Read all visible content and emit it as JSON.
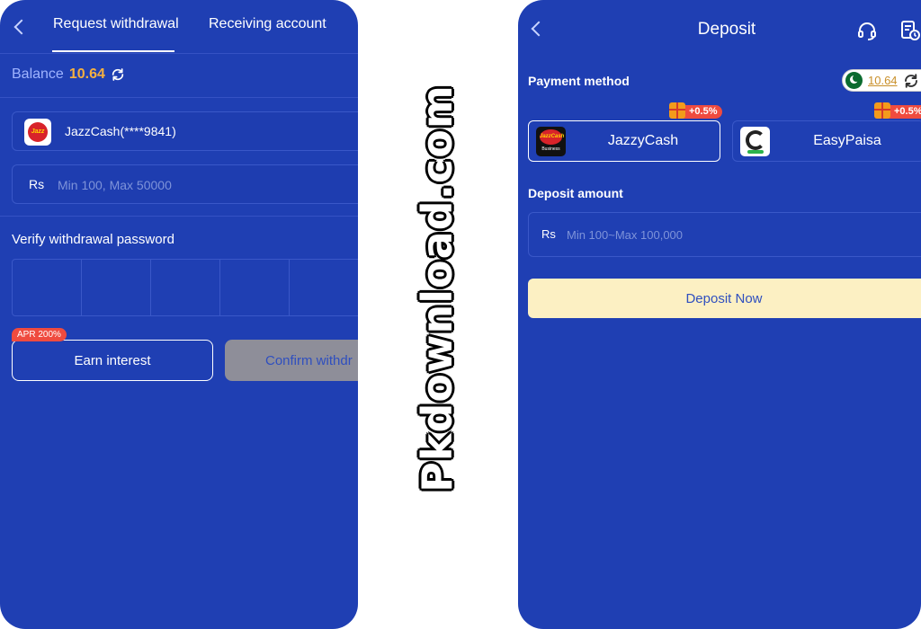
{
  "left": {
    "tabs": [
      "Request withdrawal",
      "Receiving account"
    ],
    "balance_label": "Balance",
    "balance_value": "10.64",
    "account": "JazzCash(****9841)",
    "jazz_logo_text": "Jazz",
    "currency_label": "Rs",
    "amount_placeholder": "Min 100, Max 50000",
    "verify_label": "Verify withdrawal password",
    "apr_badge": "APR 200%",
    "earn_label": "Earn interest",
    "confirm_label": "Confirm withdr"
  },
  "watermark": "Pkdownload.com",
  "right": {
    "title": "Deposit",
    "payment_method_label": "Payment method",
    "balance_value": "10.64",
    "methods": [
      {
        "name": "JazzyCash",
        "bonus": "+0.5%",
        "logo_text": "JazzCash",
        "logo_sub": "Business"
      },
      {
        "name": "EasyPaisa",
        "bonus": "+0.5%"
      }
    ],
    "deposit_amount_label": "Deposit amount",
    "currency_label": "Rs",
    "amount_placeholder": "Min 100~Max 100,000",
    "deposit_button": "Deposit Now"
  },
  "colors": {
    "panel_bg": "#1f3fb3",
    "balance_accent": "#f5b040",
    "badge_red": "#ef4b3f",
    "deposit_button_bg": "#fcf0c3",
    "disabled_button_bg": "#8e8e99"
  }
}
